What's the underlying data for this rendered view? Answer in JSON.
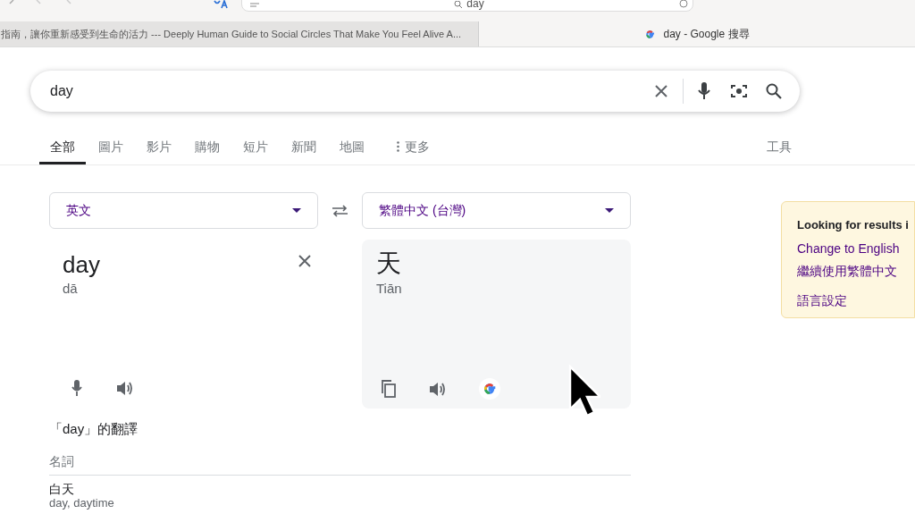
{
  "browser": {
    "address": "day",
    "tabs": [
      {
        "title": "指南，讓你重新感受到生命的活力 --- Deeply Human Guide to Social Circles That Make You Feel Alive A...",
        "selected": false
      },
      {
        "title": "day - Google 搜尋",
        "selected": true
      }
    ]
  },
  "search": {
    "value": "day"
  },
  "nav_tabs": [
    {
      "label": "全部",
      "selected": true
    },
    {
      "label": "圖片",
      "selected": false
    },
    {
      "label": "影片",
      "selected": false
    },
    {
      "label": "購物",
      "selected": false
    },
    {
      "label": "短片",
      "selected": false
    },
    {
      "label": "新聞",
      "selected": false
    },
    {
      "label": "地圖",
      "selected": false
    }
  ],
  "more": {
    "label": "更多"
  },
  "tools": "工具",
  "translate": {
    "source_lang": "英文",
    "target_lang": "繁體中文 (台灣)",
    "source_text": "day",
    "source_phonetic": "dā",
    "target_text": "天",
    "target_phonetic": "Tiān"
  },
  "translations": {
    "heading": "「day」的翻譯",
    "part_of_speech": "名詞",
    "entries": [
      {
        "term": "白天",
        "glosses": "day, daytime"
      }
    ]
  },
  "language_notice": {
    "title": "Looking for results i",
    "links": [
      "Change to English",
      "繼續使用繁體中文"
    ],
    "settings": "語言設定"
  }
}
